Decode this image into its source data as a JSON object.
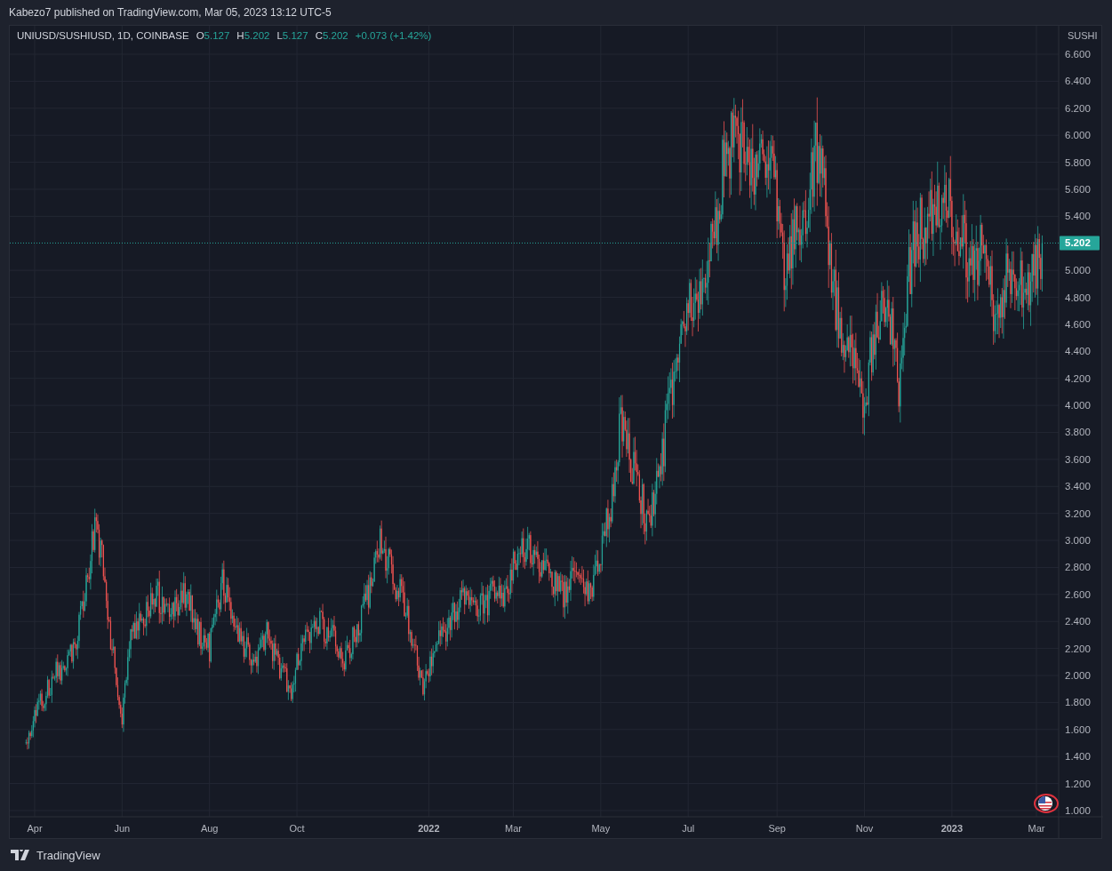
{
  "header": {
    "title": "Kabezo7 published on TradingView.com, Mar 05, 2023 13:12 UTC-5"
  },
  "legend": {
    "symbol": "UNIUSD/SUSHIUSD, 1D, COINBASE",
    "fields": [
      {
        "label": "O",
        "value": "5.127"
      },
      {
        "label": "H",
        "value": "5.202"
      },
      {
        "label": "L",
        "value": "5.127"
      },
      {
        "label": "C",
        "value": "5.202"
      }
    ],
    "change": "+0.073 (+1.42%)"
  },
  "price_axis": {
    "unit": "SUSHI",
    "labels": [
      "6.600",
      "6.400",
      "6.200",
      "6.000",
      "5.800",
      "5.600",
      "5.400",
      "5.000",
      "4.800",
      "4.600",
      "4.400",
      "4.200",
      "4.000",
      "3.800",
      "3.600",
      "3.400",
      "3.200",
      "3.000",
      "2.800",
      "2.600",
      "2.400",
      "2.200",
      "2.000",
      "1.800",
      "1.600",
      "1.400",
      "1.200",
      "1.000"
    ]
  },
  "price_marker": {
    "value": "5.202"
  },
  "time_axis": {
    "labels": [
      {
        "label": "Apr",
        "year": false
      },
      {
        "label": "Jun",
        "year": false
      },
      {
        "label": "Aug",
        "year": false
      },
      {
        "label": "Oct",
        "year": false
      },
      {
        "label": "2022",
        "year": true
      },
      {
        "label": "Mar",
        "year": false
      },
      {
        "label": "May",
        "year": false
      },
      {
        "label": "Jul",
        "year": false
      },
      {
        "label": "Sep",
        "year": false
      },
      {
        "label": "Nov",
        "year": false
      },
      {
        "label": "2023",
        "year": true
      },
      {
        "label": "Mar",
        "year": false
      }
    ]
  },
  "footer": {
    "brand": "TradingView"
  }
}
